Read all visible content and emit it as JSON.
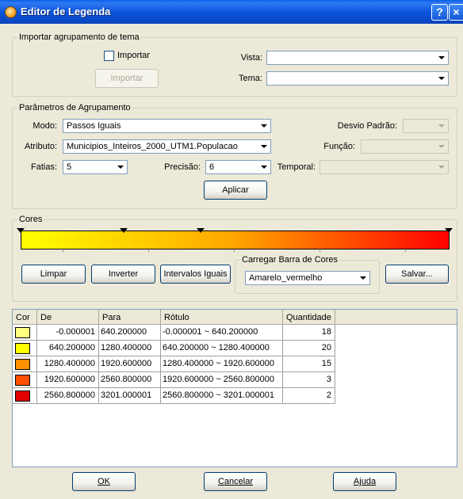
{
  "window": {
    "title": "Editor de Legenda",
    "help_label": "?",
    "close_label": "×"
  },
  "import_group": {
    "title": "Importar agrupamento de tema",
    "checkbox_label": "Importar",
    "checkbox_checked": false,
    "import_button": "Importar",
    "vista_label": "Vista:",
    "vista_value": "",
    "tema_label": "Tema:",
    "tema_value": ""
  },
  "params_group": {
    "title": "Parâmetros de Agrupamento",
    "modo_label": "Modo:",
    "modo_value": "Passos Iguais",
    "atributo_label": "Atributo:",
    "atributo_value": "Municipios_Inteiros_2000_UTM1.Populacao",
    "fatias_label": "Fatias:",
    "fatias_value": "5",
    "precisao_label": "Precisão:",
    "precisao_value": "6",
    "desvio_label": "Desvio Padrão:",
    "desvio_value": "",
    "funcao_label": "Função:",
    "funcao_value": "",
    "temporal_label": "Temporal:",
    "temporal_value": "",
    "aplicar_label": "Aplicar"
  },
  "colors_group": {
    "title": "Cores",
    "gradient_colors": [
      "#ffff00",
      "#ffa500",
      "#ff0000"
    ],
    "limpar_label": "Limpar",
    "inverter_label": "Inverter",
    "intervalos_label": "Intervalos Iguais",
    "carregar_title": "Carregar Barra de Cores",
    "carregar_value": "Amarelo_vermelho",
    "salvar_label": "Salvar..."
  },
  "legend_table": {
    "headers": [
      "Cor",
      "De",
      "Para",
      "Rótulo",
      "Quantidade"
    ],
    "rows": [
      {
        "color": "#ffff80",
        "de": "-0.000001",
        "para": "640.200000",
        "rotulo": "-0.000001 ~ 640.200000",
        "quantidade": "18"
      },
      {
        "color": "#ffff00",
        "de": "640.200000",
        "para": "1280.400000",
        "rotulo": "640.200000 ~ 1280.400000",
        "quantidade": "20"
      },
      {
        "color": "#ff9000",
        "de": "1280.400000",
        "para": "1920.600000",
        "rotulo": "1280.400000 ~ 1920.600000",
        "quantidade": "15"
      },
      {
        "color": "#ff5000",
        "de": "1920.600000",
        "para": "2560.800000",
        "rotulo": "1920.600000 ~ 2560.800000",
        "quantidade": "3"
      },
      {
        "color": "#e00000",
        "de": "2560.800000",
        "para": "3201.000001",
        "rotulo": "2560.800000 ~ 3201.000001",
        "quantidade": "2"
      }
    ]
  },
  "footer": {
    "ok_label": "OK",
    "cancelar_label": "Cancelar",
    "ajuda_label": "Ajuda"
  }
}
